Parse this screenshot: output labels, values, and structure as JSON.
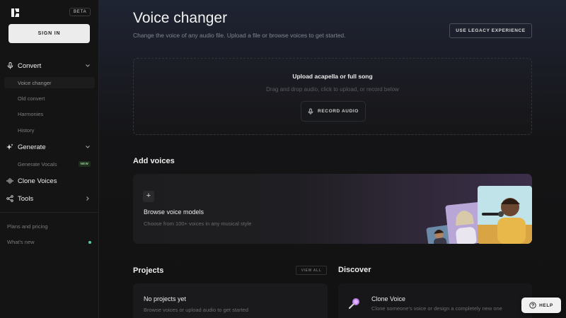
{
  "sidebar": {
    "beta_label": "BETA",
    "signin_label": "SIGN IN",
    "sections": {
      "convert": "Convert",
      "generate": "Generate",
      "clone_voices": "Clone Voices",
      "tools": "Tools"
    },
    "convert_items": [
      "Voice changer",
      "Old convert",
      "Harmonies",
      "History"
    ],
    "generate_items": [
      {
        "label": "Generate Vocals",
        "badge": "NEW"
      }
    ],
    "footer": {
      "plans": "Plans and pricing",
      "whats_new": "What's new"
    }
  },
  "main": {
    "title": "Voice changer",
    "subtitle": "Change the voice of any audio file. Upload a file or browse voices to get started.",
    "legacy_button": "USE LEGACY EXPERIENCE",
    "upload": {
      "title": "Upload acapella or full song",
      "subtitle": "Drag and drop audio, click to upload, or record below",
      "record_button": "RECORD AUDIO"
    },
    "add_voices": {
      "heading": "Add voices",
      "card_title": "Browse voice models",
      "card_subtitle": "Choose from 100+ voices in any musical style"
    },
    "projects": {
      "heading": "Projects",
      "view_all": "VIEW ALL",
      "empty_title": "No projects yet",
      "empty_subtitle": "Browse voices or upload audio to get started"
    },
    "discover": {
      "heading": "Discover",
      "card_title": "Clone Voice",
      "card_subtitle": "Clone someone's voice or design a completely new one"
    },
    "help_button": "HELP"
  },
  "colors": {
    "accent_green": "#4fd39a",
    "background": "#101010",
    "sidebar": "#141414"
  }
}
